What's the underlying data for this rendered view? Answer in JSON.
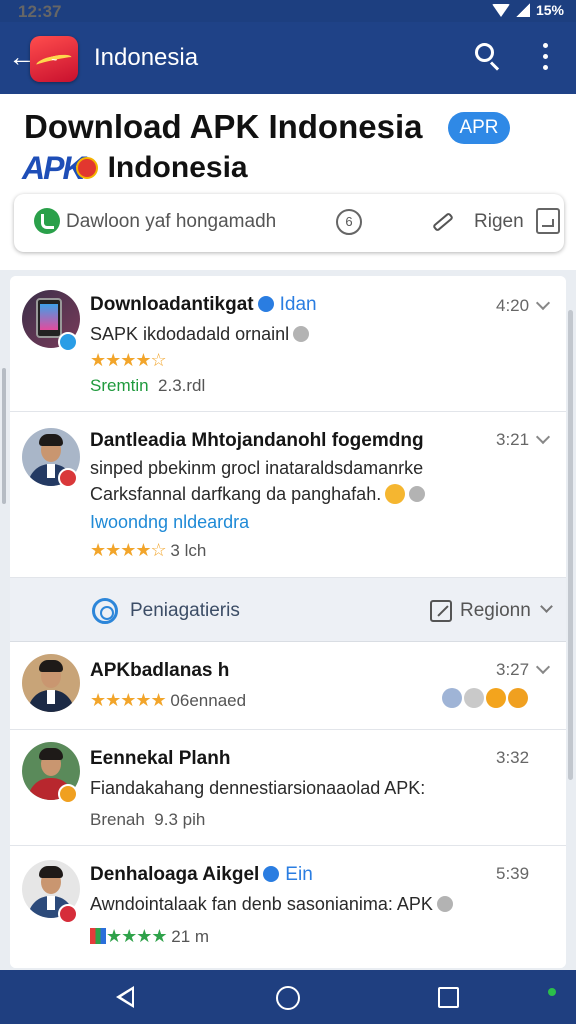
{
  "status_bar": {
    "time": "12:37",
    "battery": "15%"
  },
  "app_bar": {
    "title": "Indonesia"
  },
  "header": {
    "title": "Download APK Indonesia",
    "badge": "APR",
    "brand_logo": "APK",
    "brand_name": "Indonesia"
  },
  "search_card": {
    "placeholder": "Dawloon yaf hongamadh",
    "filter_label": "Rigen"
  },
  "items": [
    {
      "name": "Downloadantikgat",
      "verified_tag": "Idan",
      "time": "4:20",
      "line1": "SAPK ikdodadald ornainl",
      "stars": "★★★★☆",
      "meta_left": "Sremtin",
      "meta_right": "2.3.rdl"
    },
    {
      "name": "Dantleadia Mhtojandanohl fogemdng",
      "time": "3:21",
      "line1": "sinped pbekinm grocl inataraldsdamanrke",
      "line2": "Carksfannal darfkang da panghafah.",
      "line3": "Iwoondng nldeardra",
      "stars": "★★★★☆",
      "meta_right": "3 lch"
    },
    {
      "name": "APKbadlanas h",
      "time": "3:27",
      "stars": "★★★★★",
      "meta_right": "06ennaed"
    },
    {
      "name": "Eennekal Planh",
      "time": "3:32",
      "line1": "Fiandakahang dennestiarsionaaolad APK:",
      "meta_left": "Brenah",
      "meta_right": "9.3 pih"
    },
    {
      "name": "Denhaloaga Aikgel",
      "verified_tag": "Ein",
      "time": "5:39",
      "line1": "Awndointalaak fan denb sasonianima: APK",
      "stars": "★★★★",
      "meta_right": "21 m"
    }
  ],
  "section": {
    "title": "Peniagatieris",
    "action": "Regionn"
  },
  "icons": {
    "brand_red": "#d02b2b",
    "brand_blue": "#1e4eb7",
    "appbar": "#1f4287",
    "accent_blue": "#2f89e6",
    "star": "#f2a52b"
  }
}
